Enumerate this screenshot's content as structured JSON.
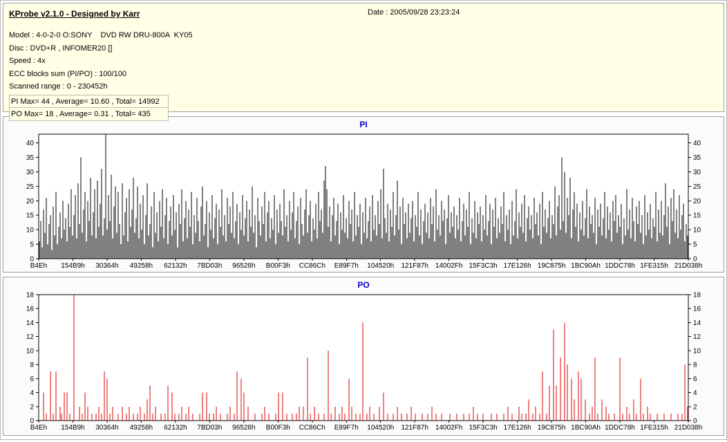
{
  "header": {
    "title": "KProbe v2.1.0 - Designed by Karr",
    "date": "Date : 2005/09/28 23:23:24"
  },
  "info": {
    "model": "Model : 4-0-2-0 O:SONY    DVD RW DRU-800A  KY05",
    "disc": "Disc : DVD+R , INFOMER20 []",
    "speed": "Speed : 4x",
    "ecc": "ECC blocks sum (PI/PO) : 100/100",
    "scanned_range": "Scanned range : 0 - 230452h",
    "pi_stats": "PI Max= 44 , Average= 10.60 , Total= 14992",
    "po_stats": "PO Max= 18 , Average= 0.31 , Total= 435"
  },
  "colors": {
    "header_bg": "#ffffe6",
    "chart_title": "#0000cc",
    "pi_bars": "#000000",
    "po_bars": "#dd0000"
  },
  "chart_data": [
    {
      "id": "pi",
      "type": "bar",
      "title": "PI",
      "color": "#000000",
      "ylim": [
        0,
        43
      ],
      "yticks": [
        0,
        5,
        10,
        15,
        20,
        25,
        30,
        35,
        40
      ],
      "grid": false,
      "legend": "none",
      "x_tick_labels": [
        "B4Eh",
        "154B9h",
        "30364h",
        "49258h",
        "62132h",
        "7BD03h",
        "96528h",
        "B00F3h",
        "CC86Ch",
        "E89F7h",
        "104520h",
        "121F87h",
        "14002Fh",
        "15F3C3h",
        "17E126h",
        "19C875h",
        "1BC90Ah",
        "1DDC78h",
        "1FE315h",
        "21D038h"
      ],
      "stats": {
        "max": 44,
        "average": 10.6,
        "total": 14992
      },
      "n_points": 470,
      "values": [
        6,
        13,
        4,
        17,
        9,
        21,
        5,
        12,
        15,
        3,
        18,
        8,
        23,
        5,
        11,
        16,
        7,
        20,
        10,
        14,
        6,
        19,
        11,
        24,
        8,
        15,
        22,
        7,
        26,
        12,
        35,
        9,
        17,
        23,
        6,
        20,
        13,
        28,
        8,
        16,
        24,
        7,
        27,
        11,
        19,
        31,
        8,
        14,
        44,
        10,
        22,
        13,
        29,
        7,
        18,
        25,
        9,
        23,
        12,
        5,
        26,
        8,
        16,
        21,
        6,
        24,
        11,
        17,
        28,
        9,
        14,
        25,
        7,
        19,
        10,
        22,
        5,
        15,
        26,
        8,
        12,
        18,
        4,
        23,
        9,
        16,
        6,
        20,
        11,
        24,
        7,
        15,
        21,
        5,
        13,
        18,
        8,
        22,
        10,
        16,
        4,
        19,
        12,
        24,
        6,
        14,
        20,
        7,
        17,
        11,
        23,
        5,
        15,
        9,
        21,
        13,
        6,
        18,
        25,
        8,
        12,
        20,
        4,
        16,
        10,
        22,
        7,
        14,
        19,
        5,
        17,
        11,
        24,
        8,
        15,
        6,
        21,
        12,
        18,
        9,
        23,
        7,
        13,
        19,
        5,
        16,
        10,
        22,
        8,
        14,
        20,
        6,
        17,
        11,
        25,
        9,
        15,
        4,
        21,
        13,
        8,
        18,
        12,
        23,
        6,
        16,
        20,
        7,
        14,
        10,
        22,
        5,
        17,
        9,
        19,
        13,
        8,
        24,
        11,
        15,
        6,
        20,
        10,
        16,
        23,
        7,
        13,
        18,
        5,
        21,
        12,
        8,
        17,
        24,
        9,
        15,
        20,
        6,
        14,
        10,
        19,
        7,
        23,
        13,
        17,
        9,
        27,
        32,
        24,
        11,
        18,
        6,
        15,
        21,
        8,
        13,
        19,
        5,
        16,
        10,
        22,
        9,
        14,
        7,
        20,
        12,
        17,
        6,
        23,
        8,
        15,
        11,
        19,
        5,
        16,
        9,
        21,
        7,
        13,
        18,
        6,
        22,
        10,
        15,
        8,
        20,
        12,
        24,
        7,
        31,
        14,
        9,
        19,
        6,
        17,
        11,
        23,
        8,
        15,
        27,
        10,
        18,
        5,
        21,
        12,
        16,
        7,
        19,
        9,
        14,
        20,
        6,
        15,
        11,
        23,
        8,
        17,
        5,
        13,
        19,
        9,
        16,
        7,
        21,
        12,
        18,
        6,
        24,
        10,
        15,
        8,
        20,
        13,
        17,
        5,
        14,
        22,
        9,
        16,
        11,
        18,
        7,
        15,
        10,
        21,
        6,
        13,
        19,
        8,
        17,
        11,
        23,
        5,
        14,
        9,
        20,
        7,
        16,
        12,
        18,
        6,
        15,
        10,
        22,
        8,
        13,
        19,
        5,
        17,
        11,
        21,
        7,
        14,
        9,
        18,
        12,
        23,
        6,
        15,
        10,
        17,
        5,
        20,
        8,
        13,
        24,
        7,
        16,
        11,
        19,
        9,
        22,
        6,
        14,
        18,
        10,
        15,
        7,
        21,
        12,
        16,
        8,
        19,
        5,
        23,
        11,
        17,
        9,
        14,
        20,
        7,
        15,
        12,
        25,
        8,
        18,
        22,
        10,
        35,
        13,
        30,
        9,
        21,
        15,
        28,
        7,
        17,
        23,
        11,
        19,
        6,
        16,
        10,
        20,
        8,
        14,
        24,
        7,
        18,
        12,
        15,
        9,
        21,
        5,
        17,
        11,
        19,
        8,
        14,
        23,
        7,
        18,
        10,
        16,
        6,
        20,
        13,
        22,
        9,
        15,
        11,
        19,
        5,
        14,
        8,
        24,
        10,
        17,
        7,
        21,
        13,
        6,
        18,
        12,
        20,
        9,
        15,
        5,
        22,
        8,
        16,
        10,
        19,
        7,
        14,
        11,
        23,
        6,
        17,
        9,
        20,
        8,
        15,
        26,
        11,
        18,
        5,
        21,
        13,
        24,
        9,
        17,
        7,
        22,
        10,
        15,
        19,
        6,
        12,
        8
      ]
    },
    {
      "id": "po",
      "type": "bar",
      "title": "PO",
      "color": "#dd0000",
      "ylim": [
        0,
        18
      ],
      "yticks": [
        0,
        2,
        4,
        6,
        8,
        10,
        12,
        14,
        16,
        18
      ],
      "grid": false,
      "legend": "none",
      "x_tick_labels": [
        "B4Eh",
        "154B9h",
        "30364h",
        "49258h",
        "62132h",
        "7BD03h",
        "96528h",
        "B00F3h",
        "CC86Ch",
        "E89F7h",
        "104520h",
        "121F87h",
        "14002Fh",
        "15F3C3h",
        "17E126h",
        "19C875h",
        "1BC90Ah",
        "1DDC78h",
        "1FE315h",
        "21D038h"
      ],
      "stats": {
        "max": 18,
        "average": 0.31,
        "total": 435
      },
      "n_points": 470,
      "points": [
        [
          3,
          4
        ],
        [
          5,
          1
        ],
        [
          8,
          7
        ],
        [
          10,
          1
        ],
        [
          12,
          7
        ],
        [
          15,
          2
        ],
        [
          16,
          1
        ],
        [
          18,
          4
        ],
        [
          20,
          4
        ],
        [
          22,
          1
        ],
        [
          25,
          18
        ],
        [
          29,
          2
        ],
        [
          31,
          1
        ],
        [
          33,
          4
        ],
        [
          35,
          2
        ],
        [
          38,
          1
        ],
        [
          41,
          1
        ],
        [
          43,
          2
        ],
        [
          45,
          1
        ],
        [
          47,
          7
        ],
        [
          49,
          6
        ],
        [
          51,
          1
        ],
        [
          53,
          2
        ],
        [
          57,
          1
        ],
        [
          60,
          2
        ],
        [
          63,
          1
        ],
        [
          65,
          2
        ],
        [
          68,
          1
        ],
        [
          71,
          1
        ],
        [
          73,
          2
        ],
        [
          76,
          1
        ],
        [
          78,
          3
        ],
        [
          80,
          5
        ],
        [
          82,
          1
        ],
        [
          84,
          2
        ],
        [
          88,
          1
        ],
        [
          91,
          1
        ],
        [
          93,
          5
        ],
        [
          96,
          4
        ],
        [
          98,
          1
        ],
        [
          101,
          1
        ],
        [
          103,
          2
        ],
        [
          106,
          1
        ],
        [
          108,
          2
        ],
        [
          111,
          1
        ],
        [
          116,
          1
        ],
        [
          118,
          4
        ],
        [
          121,
          4
        ],
        [
          123,
          1
        ],
        [
          126,
          1
        ],
        [
          128,
          2
        ],
        [
          131,
          1
        ],
        [
          136,
          1
        ],
        [
          138,
          2
        ],
        [
          141,
          1
        ],
        [
          143,
          7
        ],
        [
          146,
          6
        ],
        [
          148,
          4
        ],
        [
          151,
          2
        ],
        [
          156,
          1
        ],
        [
          161,
          1
        ],
        [
          163,
          2
        ],
        [
          166,
          1
        ],
        [
          171,
          1
        ],
        [
          173,
          4
        ],
        [
          176,
          4
        ],
        [
          179,
          1
        ],
        [
          183,
          1
        ],
        [
          186,
          1
        ],
        [
          188,
          2
        ],
        [
          191,
          2
        ],
        [
          194,
          9
        ],
        [
          196,
          1
        ],
        [
          199,
          2
        ],
        [
          202,
          1
        ],
        [
          206,
          1
        ],
        [
          209,
          10
        ],
        [
          211,
          1
        ],
        [
          214,
          2
        ],
        [
          217,
          1
        ],
        [
          219,
          2
        ],
        [
          221,
          1
        ],
        [
          224,
          6
        ],
        [
          226,
          2
        ],
        [
          229,
          1
        ],
        [
          232,
          1
        ],
        [
          234,
          14
        ],
        [
          237,
          1
        ],
        [
          239,
          2
        ],
        [
          242,
          1
        ],
        [
          246,
          2
        ],
        [
          249,
          4
        ],
        [
          252,
          1
        ],
        [
          256,
          1
        ],
        [
          259,
          2
        ],
        [
          262,
          1
        ],
        [
          266,
          1
        ],
        [
          269,
          2
        ],
        [
          272,
          1
        ],
        [
          277,
          1
        ],
        [
          281,
          1
        ],
        [
          284,
          2
        ],
        [
          287,
          1
        ],
        [
          291,
          1
        ],
        [
          297,
          1
        ],
        [
          302,
          1
        ],
        [
          307,
          1
        ],
        [
          311,
          1
        ],
        [
          314,
          2
        ],
        [
          317,
          1
        ],
        [
          321,
          1
        ],
        [
          327,
          1
        ],
        [
          331,
          1
        ],
        [
          336,
          1
        ],
        [
          339,
          2
        ],
        [
          342,
          1
        ],
        [
          347,
          2
        ],
        [
          349,
          1
        ],
        [
          352,
          1
        ],
        [
          354,
          3
        ],
        [
          357,
          1
        ],
        [
          359,
          2
        ],
        [
          362,
          1
        ],
        [
          364,
          7
        ],
        [
          367,
          1
        ],
        [
          369,
          5
        ],
        [
          372,
          13
        ],
        [
          374,
          5
        ],
        [
          377,
          9
        ],
        [
          380,
          14
        ],
        [
          382,
          8
        ],
        [
          385,
          6
        ],
        [
          387,
          3
        ],
        [
          390,
          7
        ],
        [
          392,
          6
        ],
        [
          395,
          3
        ],
        [
          398,
          1
        ],
        [
          400,
          2
        ],
        [
          402,
          9
        ],
        [
          404,
          1
        ],
        [
          407,
          3
        ],
        [
          410,
          2
        ],
        [
          412,
          1
        ],
        [
          416,
          1
        ],
        [
          420,
          9
        ],
        [
          422,
          1
        ],
        [
          425,
          2
        ],
        [
          427,
          1
        ],
        [
          430,
          3
        ],
        [
          432,
          1
        ],
        [
          435,
          6
        ],
        [
          437,
          1
        ],
        [
          440,
          2
        ],
        [
          442,
          1
        ],
        [
          447,
          1
        ],
        [
          452,
          1
        ],
        [
          457,
          1
        ],
        [
          462,
          1
        ],
        [
          465,
          1
        ],
        [
          467,
          8
        ],
        [
          469,
          2
        ]
      ]
    }
  ]
}
